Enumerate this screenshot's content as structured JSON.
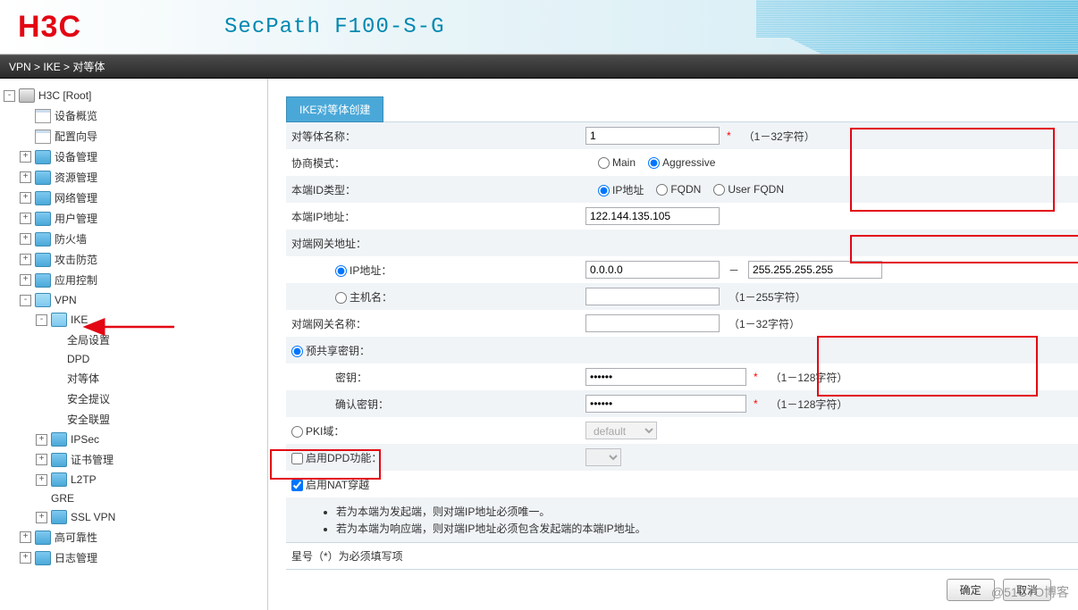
{
  "header": {
    "logo": "H3C",
    "product": "SecPath F100-S-G"
  },
  "breadcrumb": [
    "VPN",
    "IKE",
    "对等体"
  ],
  "tree_root": "H3C [Root]",
  "tree": [
    {
      "label": "设备概览",
      "icon": "page",
      "depth": 1,
      "exp": ""
    },
    {
      "label": "配置向导",
      "icon": "page",
      "depth": 1,
      "exp": ""
    },
    {
      "label": "设备管理",
      "icon": "folder",
      "depth": 1,
      "exp": "+"
    },
    {
      "label": "资源管理",
      "icon": "folder",
      "depth": 1,
      "exp": "+"
    },
    {
      "label": "网络管理",
      "icon": "folder",
      "depth": 1,
      "exp": "+"
    },
    {
      "label": "用户管理",
      "icon": "folder",
      "depth": 1,
      "exp": "+"
    },
    {
      "label": "防火墙",
      "icon": "folder",
      "depth": 1,
      "exp": "+"
    },
    {
      "label": "攻击防范",
      "icon": "folder",
      "depth": 1,
      "exp": "+"
    },
    {
      "label": "应用控制",
      "icon": "folder",
      "depth": 1,
      "exp": "+"
    },
    {
      "label": "VPN",
      "icon": "folder-o",
      "depth": 1,
      "exp": "-"
    },
    {
      "label": "IKE",
      "icon": "folder-o",
      "depth": 2,
      "exp": "-"
    },
    {
      "label": "全局设置",
      "icon": "",
      "depth": 3,
      "exp": ""
    },
    {
      "label": "DPD",
      "icon": "",
      "depth": 3,
      "exp": ""
    },
    {
      "label": "对等体",
      "icon": "",
      "depth": 3,
      "exp": ""
    },
    {
      "label": "安全提议",
      "icon": "",
      "depth": 3,
      "exp": ""
    },
    {
      "label": "安全联盟",
      "icon": "",
      "depth": 3,
      "exp": ""
    },
    {
      "label": "IPSec",
      "icon": "folder",
      "depth": 2,
      "exp": "+"
    },
    {
      "label": "证书管理",
      "icon": "folder",
      "depth": 2,
      "exp": "+"
    },
    {
      "label": "L2TP",
      "icon": "folder",
      "depth": 2,
      "exp": "+"
    },
    {
      "label": "GRE",
      "icon": "",
      "depth": 2,
      "exp": ""
    },
    {
      "label": "SSL VPN",
      "icon": "folder",
      "depth": 2,
      "exp": "+"
    },
    {
      "label": "高可靠性",
      "icon": "folder",
      "depth": 1,
      "exp": "+"
    },
    {
      "label": "日志管理",
      "icon": "folder",
      "depth": 1,
      "exp": "+"
    }
  ],
  "form": {
    "title": "IKE对等体创建",
    "peer_name_label": "对等体名称：",
    "peer_name": "1",
    "peer_name_hint": "（1－32字符）",
    "nego_label": "协商模式：",
    "nego_main": "Main",
    "nego_aggr": "Aggressive",
    "local_idtype_label": "本端ID类型：",
    "idtype_ip": "IP地址",
    "idtype_fqdn": "FQDN",
    "idtype_ufqdn": "User FQDN",
    "local_ip_label": "本端IP地址：",
    "local_ip": "122.144.135.105",
    "remote_gw_label": "对端网关地址：",
    "gw_ip_opt": "IP地址：",
    "gw_ip_start": "0.0.0.0",
    "gw_ip_dash": "－",
    "gw_ip_end": "255.255.255.255",
    "gw_host_opt": "主机名：",
    "gw_host_hint": "（1－255字符）",
    "remote_gw_name_label": "对端网关名称：",
    "remote_gw_name_hint": "（1－32字符）",
    "psk_opt": "预共享密钥：",
    "key_label": "密钥：",
    "key_val": "••••••",
    "key_hint": "（1－128字符）",
    "key2_label": "确认密钥：",
    "key2_val": "••••••",
    "key2_hint": "（1－128字符）",
    "pki_opt": "PKI域：",
    "pki_val": "default",
    "dpd_label": "启用DPD功能：",
    "nat_label": "启用NAT穿越",
    "note1": "若为本端为发起端，则对端IP地址必须唯一。",
    "note2": "若为本端为响应端，则对端IP地址必须包含发起端的本端IP地址。",
    "required_note": "星号（*）为必须填写项",
    "btn_ok": "确定",
    "btn_cancel": "取消"
  },
  "watermark": "@51CTO博客"
}
